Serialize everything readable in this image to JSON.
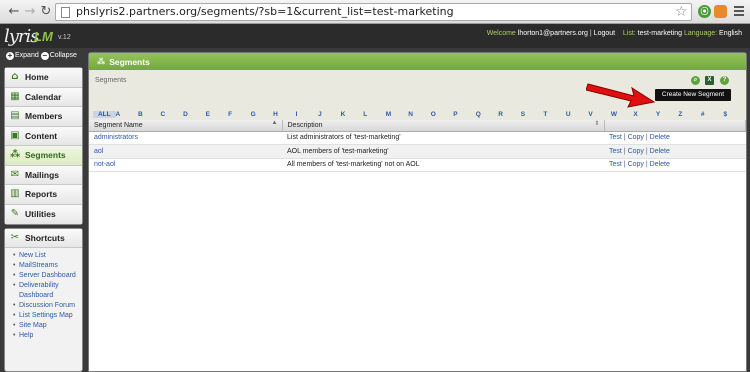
{
  "browser": {
    "url": "phslyris2.partners.org/segments/?sb=1&current_list=test-marketing",
    "back_icon": "arrow-left-icon",
    "forward_icon": "arrow-right-icon",
    "reload_icon": "reload-icon"
  },
  "header": {
    "logo_text": "lyris",
    "logo_sub": "LM",
    "version": "v.12",
    "welcome_label": "Welcome",
    "user": "lhorton1@partners.org",
    "divider": "|",
    "logout": "Logout",
    "list_label": "List:",
    "list_value": "test-marketing",
    "language_label": "Language:",
    "language_value": "English"
  },
  "sidebar": {
    "expand": "Expand",
    "collapse": "Collapse",
    "items": [
      {
        "label": "Home",
        "icon": "home-icon"
      },
      {
        "label": "Calendar",
        "icon": "calendar-icon"
      },
      {
        "label": "Members",
        "icon": "members-icon"
      },
      {
        "label": "Content",
        "icon": "content-icon"
      },
      {
        "label": "Segments",
        "icon": "segments-icon"
      },
      {
        "label": "Mailings",
        "icon": "mailings-icon"
      },
      {
        "label": "Reports",
        "icon": "reports-icon"
      },
      {
        "label": "Utilities",
        "icon": "utilities-icon"
      }
    ],
    "shortcuts_title": "Shortcuts",
    "shortcuts": [
      "New List",
      "MailStreams",
      "Server Dashboard",
      "Deliverability Dashboard",
      "Discussion Forum",
      "List Settings Map",
      "Site Map",
      "Help"
    ]
  },
  "main": {
    "title": "Segments",
    "breadcrumb": "Segments",
    "create_button": "Create New Segment",
    "alphabet": [
      "ALL",
      "A",
      "B",
      "C",
      "D",
      "E",
      "F",
      "G",
      "H",
      "I",
      "J",
      "K",
      "L",
      "M",
      "N",
      "O",
      "P",
      "Q",
      "R",
      "S",
      "T",
      "U",
      "V",
      "W",
      "X",
      "Y",
      "Z",
      "#",
      "$"
    ],
    "columns": [
      "Segment Name",
      "Description"
    ],
    "rows": [
      {
        "name": "administrators",
        "description": "List administrators of 'test-marketing'"
      },
      {
        "name": "aol",
        "description": "AOL members of 'test-marketing'"
      },
      {
        "name": "not-aol",
        "description": "All members of 'test-marketing' not on AOL"
      }
    ],
    "actions": {
      "test": "Test",
      "copy": "Copy",
      "delete": "Delete",
      "sep": "|"
    }
  },
  "colors": {
    "accent_green": "#74a83c",
    "link_blue": "#2a5aa8",
    "arrow_red": "#e01010"
  }
}
